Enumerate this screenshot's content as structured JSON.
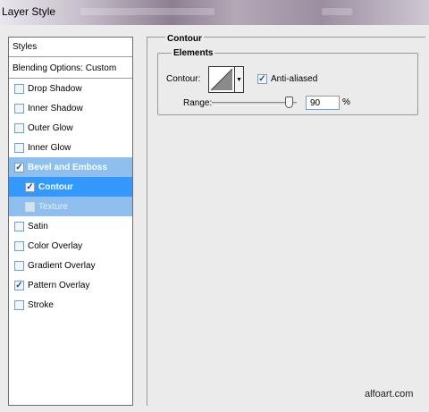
{
  "window": {
    "title": "Layer Style"
  },
  "styles_list": {
    "header": "Styles",
    "blending": "Blending Options: Custom",
    "items": [
      {
        "label": "Drop Shadow",
        "checked": false
      },
      {
        "label": "Inner Shadow",
        "checked": false
      },
      {
        "label": "Outer Glow",
        "checked": false
      },
      {
        "label": "Inner Glow",
        "checked": false
      },
      {
        "label": "Bevel and Emboss",
        "checked": true
      },
      {
        "label": "Contour",
        "checked": true
      },
      {
        "label": "Texture",
        "checked": false
      },
      {
        "label": "Satin",
        "checked": false
      },
      {
        "label": "Color Overlay",
        "checked": false
      },
      {
        "label": "Gradient Overlay",
        "checked": false
      },
      {
        "label": "Pattern Overlay",
        "checked": true
      },
      {
        "label": "Stroke",
        "checked": false
      }
    ]
  },
  "contour_panel": {
    "title": "Contour",
    "group_title": "Elements",
    "contour_label": "Contour:",
    "anti_aliased_label": "Anti-aliased",
    "anti_aliased": true,
    "range_label": "Range:",
    "range_value": "90",
    "range_unit": "%",
    "range_slider_percent": 90
  },
  "watermark": "alfoart.com",
  "colors": {
    "selected": "#3399ff",
    "parent_highlight": "#8ebfee",
    "panel_bg": "#ebebeb"
  }
}
